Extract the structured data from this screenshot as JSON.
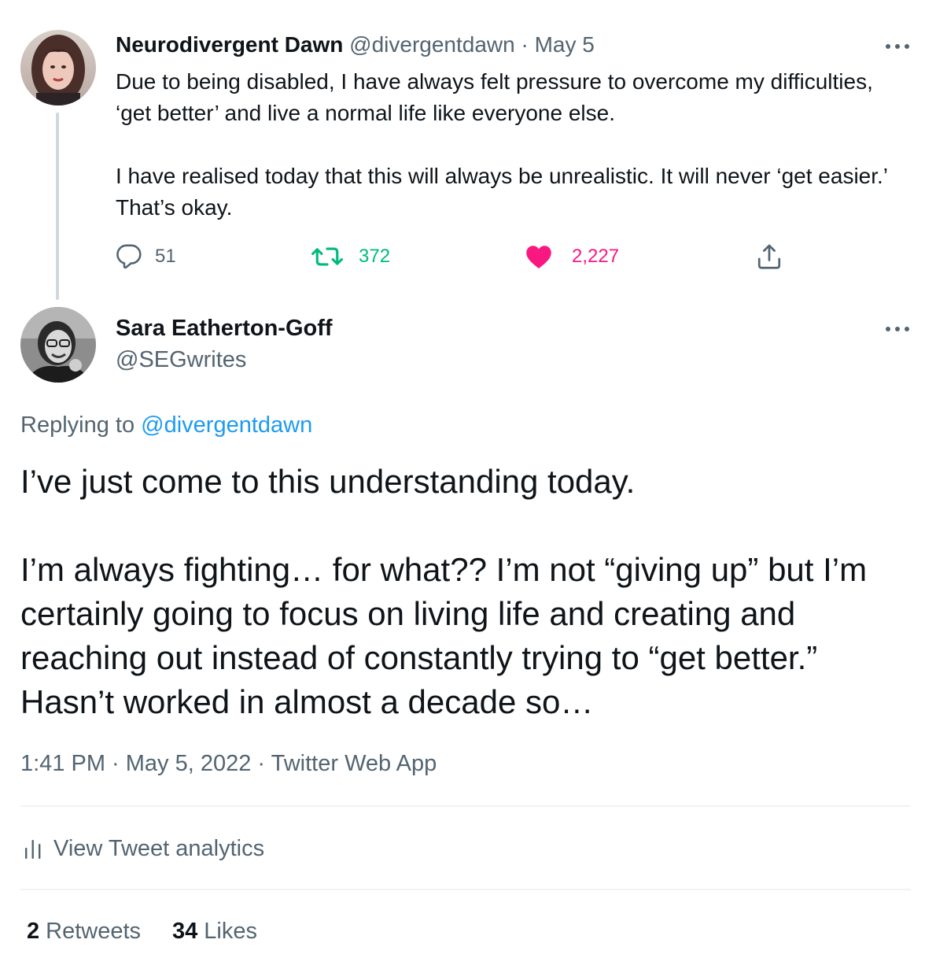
{
  "parent_tweet": {
    "display_name": "Neurodivergent Dawn",
    "handle": "@divergentdawn",
    "separator": "·",
    "date": "May 5",
    "paragraphs": [
      "Due to being disabled, I have always felt pressure to overcome my difficulties, ‘get better’ and live a normal life like everyone else.",
      "I have realised today that this will always be unrealistic. It will never ‘get easier.’ That’s okay."
    ],
    "actions": {
      "reply_count": "51",
      "retweet_count": "372",
      "like_count": "2,227"
    },
    "colors": {
      "retweet": "#00ba7c",
      "like": "#f91880",
      "muted": "#536471"
    }
  },
  "reply_tweet": {
    "display_name": "Sara Eatherton-Goff",
    "handle": "@SEGwrites",
    "replying_prefix": "Replying to",
    "replying_handle": "@divergentdawn",
    "paragraphs": [
      "I’ve just come to this understanding today.",
      "I’m always fighting… for what?? I’m not “giving up” but I’m certainly going to focus on living life and creating and reaching out instead of constantly trying to “get better.” Hasn’t worked in almost a decade so…"
    ],
    "timestamp": "1:41 PM · May 5, 2022 · Twitter Web App",
    "analytics_label": "View Tweet analytics",
    "stats": {
      "retweets_count": "2",
      "retweets_label": "Retweets",
      "likes_count": "34",
      "likes_label": "Likes"
    },
    "colors": {
      "link": "#1d9bf0",
      "text": "#0f1419"
    }
  },
  "icons": {
    "more": "more-horizontal-icon",
    "reply": "reply-icon",
    "retweet": "retweet-icon",
    "like": "heart-icon",
    "share": "share-icon",
    "analytics": "analytics-bars-icon"
  }
}
